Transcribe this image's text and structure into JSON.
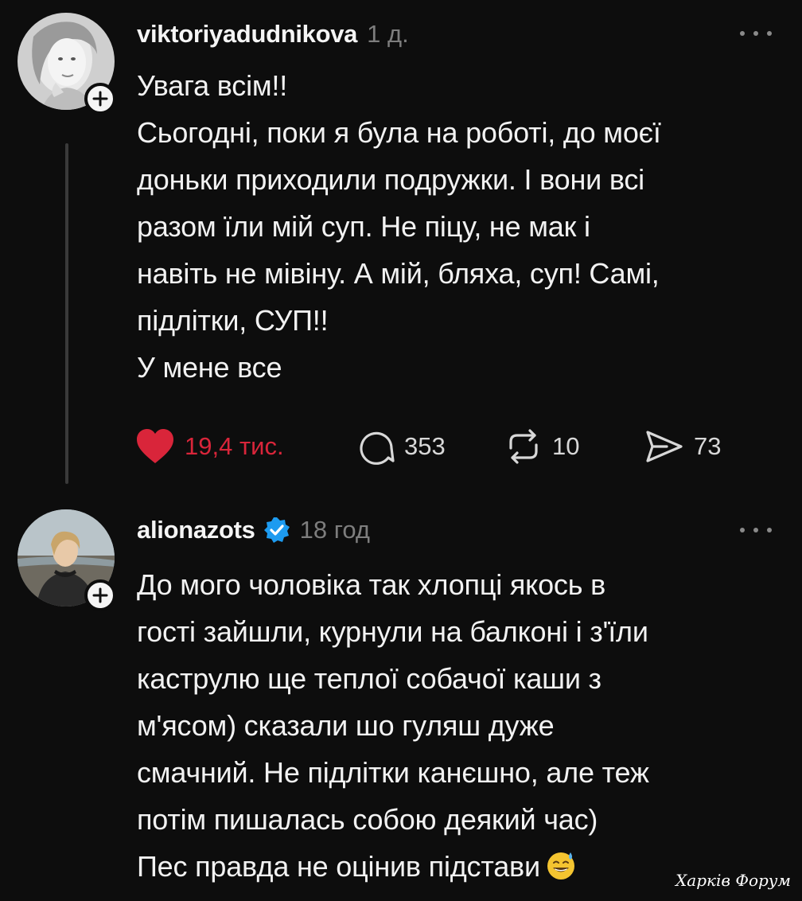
{
  "posts": [
    {
      "username": "viktoriyadudnikova",
      "time": "1 д.",
      "verified": false,
      "lines": [
        "Увага всім!!",
        "Сьогодні, поки я була на роботі, до моєї",
        "доньки приходили подружки. І вони всі",
        "разом їли мій суп. Не піцу, не мак і",
        "навіть не мівіну. А мій, бляха, суп! Самі,",
        "підлітки, СУП!!",
        "У мене все"
      ],
      "stats": {
        "likes": "19,4 тис.",
        "comments": "353",
        "reposts": "10",
        "shares": "73"
      }
    },
    {
      "username": "alionazots",
      "time": "18 год",
      "verified": true,
      "lines": [
        "До мого чоловіка так хлопці якось в",
        "гості зайшли, курнули на балконі і з'їли",
        "каструлю ще теплої собачої каши з",
        "м'ясом) сказали шо гуляш дуже",
        "смачний. Не підлітки канєшно, але теж",
        "потім пишалась собою деякий час)",
        "Пес правда не оцінив підстави"
      ],
      "emoji": "sweat-smile-emoji"
    }
  ],
  "watermark": "Харків Форум",
  "colors": {
    "background": "#0d0d0d",
    "like": "#d9253a",
    "verified": "#1d9bf0",
    "muted": "#7d7d7d"
  },
  "icons": {
    "like": "heart-icon",
    "comment": "comment-icon",
    "repost": "repost-icon",
    "share": "share-icon",
    "more": "more-icon",
    "follow": "plus-icon",
    "verified": "verified-badge-icon"
  }
}
